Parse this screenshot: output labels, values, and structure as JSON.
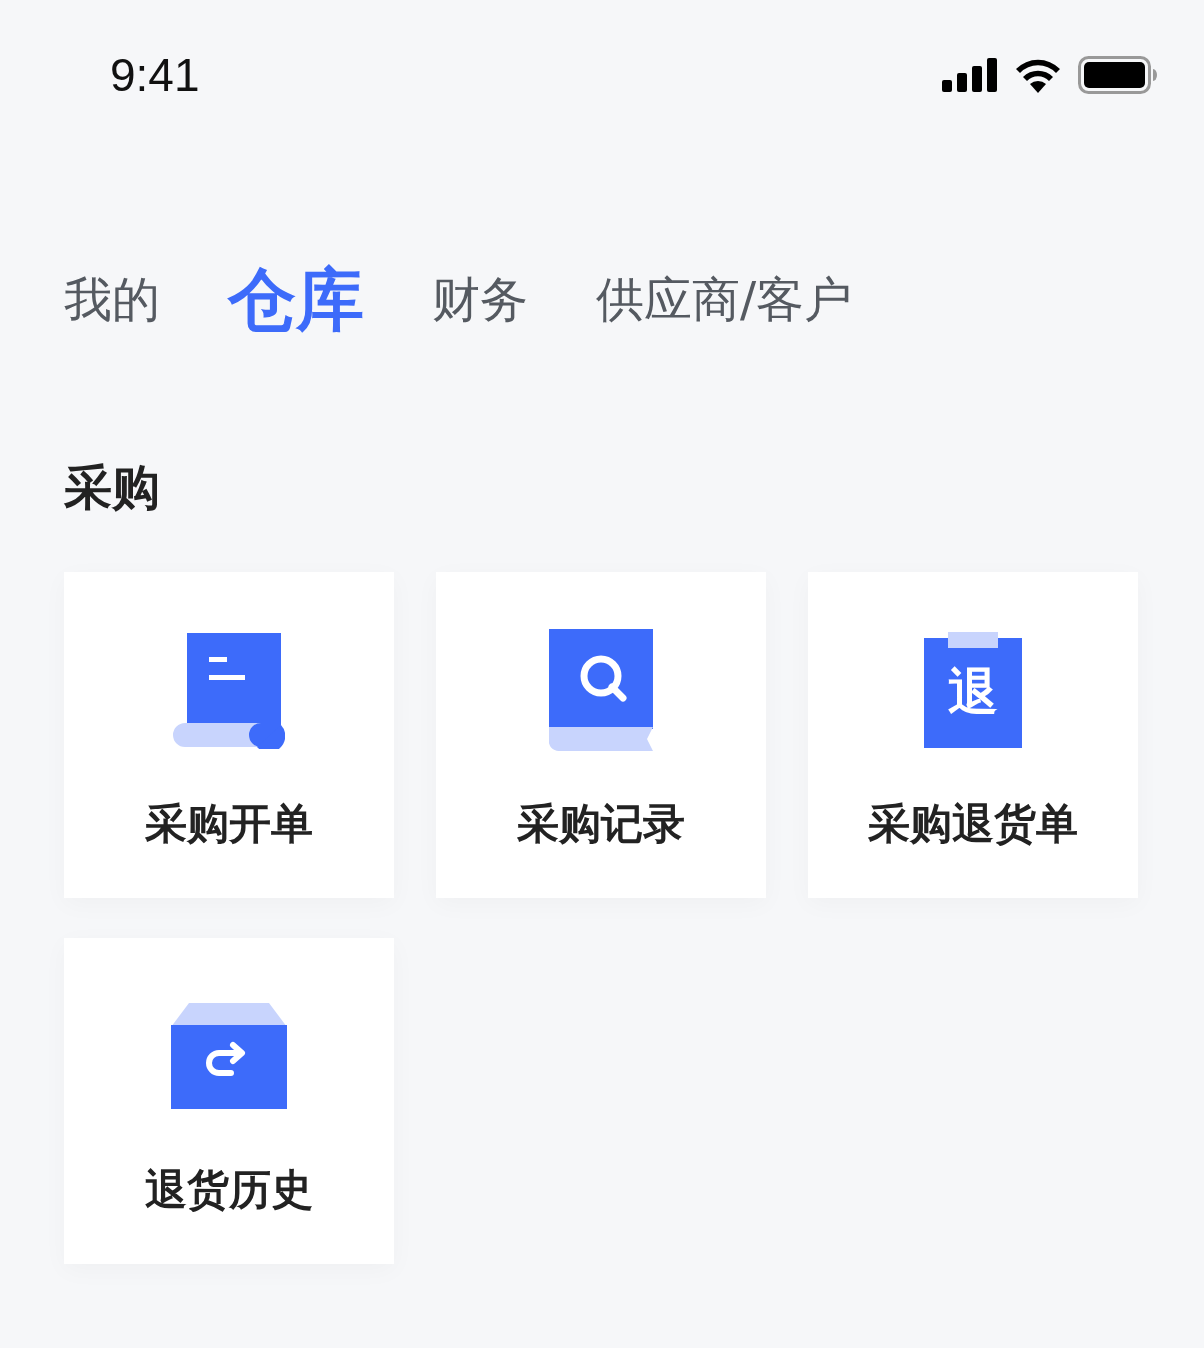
{
  "status_bar": {
    "time": "9:41"
  },
  "tabs": [
    {
      "label": "我的",
      "selected": false
    },
    {
      "label": "仓库",
      "selected": true
    },
    {
      "label": "财务",
      "selected": false
    },
    {
      "label": "供应商/客户",
      "selected": false
    }
  ],
  "section": {
    "title": "采购",
    "tiles": [
      {
        "label": "采购开单",
        "kind": "order"
      },
      {
        "label": "采购记录",
        "kind": "record"
      },
      {
        "label": "采购退货单",
        "kind": "return",
        "icon_text": "退"
      },
      {
        "label": "退货历史",
        "kind": "history"
      }
    ]
  }
}
